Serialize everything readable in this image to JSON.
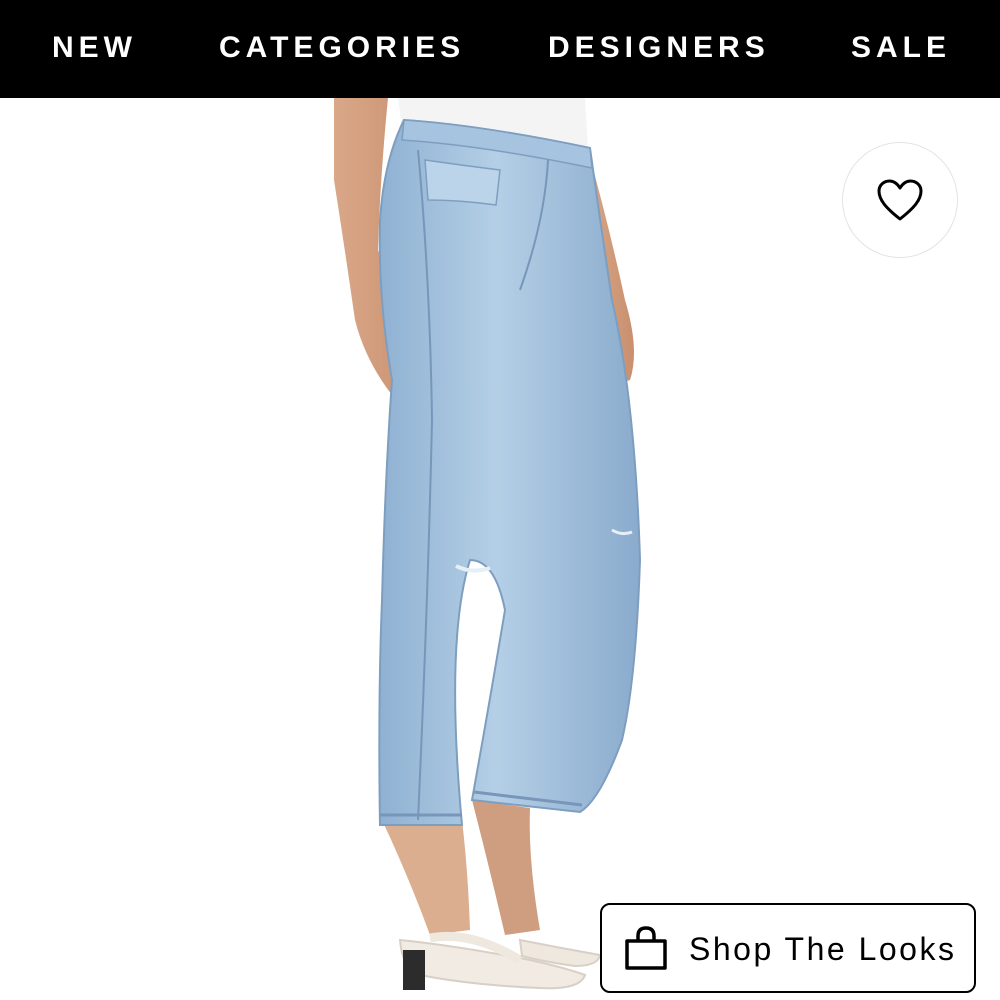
{
  "nav": {
    "items": [
      {
        "label": "NEW"
      },
      {
        "label": "CATEGORIES"
      },
      {
        "label": "DESIGNERS"
      },
      {
        "label": "SALE"
      }
    ]
  },
  "product_image": {
    "subject": "model wearing light wash straight leg cropped jeans with white sandals"
  },
  "wishlist": {
    "icon": "heart-icon"
  },
  "shop_looks": {
    "label": "Shop The Looks",
    "icon": "shopping-bag-icon"
  },
  "colors": {
    "nav_background": "#000000",
    "nav_text": "#ffffff",
    "denim": "#9ebfdc",
    "page_background": "#ffffff"
  }
}
